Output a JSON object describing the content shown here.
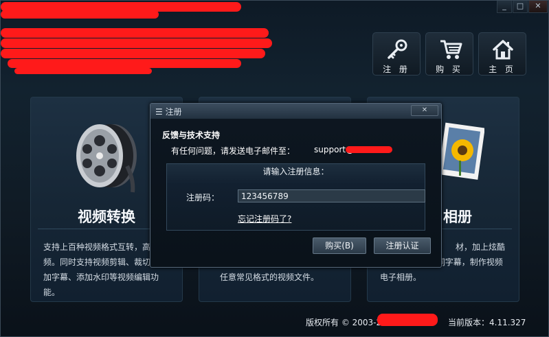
{
  "window": {
    "minimize_icon": "_",
    "maximize_icon": "□",
    "close_icon": "✕"
  },
  "toolbar": {
    "register_label": "注 册",
    "buy_label": "购 买",
    "home_label": "主 页"
  },
  "panels": [
    {
      "title": "视频转换",
      "description": "支持上百种视频格式互转，高清视频。同时支持视频剪辑、裁切、添加字幕、添加水印等视频编辑功能。"
    },
    {
      "title": "",
      "description": "任意常见格式的视频文件。"
    },
    {
      "title": "相册",
      "description": "材，加上炫酷的音乐与LRC歌词字幕，制作视频电子相册。"
    }
  ],
  "footer": {
    "copyright": "版权所有 © 2003-20",
    "version": "当前版本：4.11.327"
  },
  "dialog": {
    "title": "注册",
    "close_icon": "✕",
    "heading": "反馈与技术支持",
    "contact_text": "有任何问题，请发送电子邮件至：",
    "email_prefix": "support@",
    "reg_prompt": "请输入注册信息：",
    "reg_code_label": "注册码：",
    "reg_code_value": "123456789",
    "forgot_link": "忘记注册码了?",
    "buy_button": "购买(B)",
    "verify_button": "注册认证"
  },
  "colors": {
    "background": "#0e1a26",
    "panel": "#1b2d3e",
    "redaction": "#ff1a1a"
  },
  "icons": [
    "key-icon",
    "shopping-cart-icon",
    "home-icon",
    "film-reel-icon",
    "sunflower-photo-icon"
  ]
}
